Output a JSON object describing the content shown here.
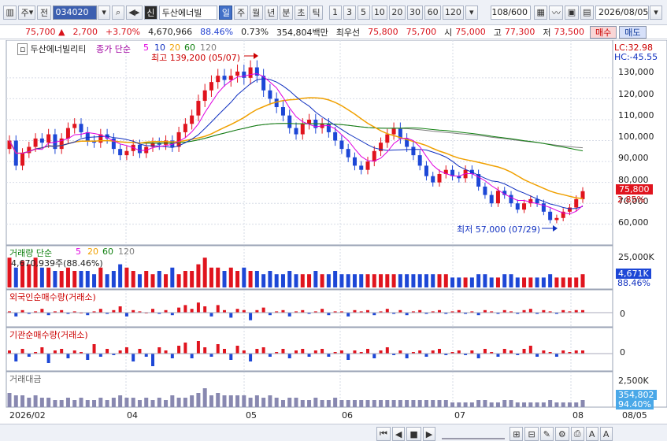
{
  "toolbar": {
    "market_label": "주",
    "period_label": "전",
    "code": "034020",
    "name": "두산에너빌",
    "credit_badge": "신",
    "period_tabs": [
      "일",
      "주",
      "월",
      "년",
      "분",
      "초",
      "틱"
    ],
    "active_period": "일",
    "ticks": [
      "1",
      "3",
      "5",
      "10",
      "20",
      "30",
      "60",
      "120"
    ],
    "count": "108/600",
    "date": "2026/08/05"
  },
  "quote": {
    "price": "75,700",
    "change": "2,700",
    "rate": "+3.70%",
    "volume": "4,670,966",
    "vol_ratio": "88.46%",
    "turnover": "0.73%",
    "amount": "354,804백만",
    "pref_label": "최우선",
    "ask": "75,800",
    "bid": "75,700",
    "open_label": "시",
    "open": "75,000",
    "high_label": "고",
    "high": "77,300",
    "low_label": "저",
    "low": "73,500",
    "buy": "매수",
    "sell": "매도"
  },
  "price_panel": {
    "title": "두산에너빌리티",
    "ma_label": "종가 단순",
    "ma_periods": [
      "5",
      "10",
      "20",
      "60",
      "120"
    ],
    "max_label": "최고 139,200 (05/07)",
    "min_label": "최저 57,000 (07/29)",
    "lc": "LC:32.98",
    "hc": "HC:-45.55",
    "current": "75,800",
    "pct": "2.85%",
    "axis": [
      "130,000",
      "120,000",
      "110,000",
      "100,000",
      "90,000",
      "80,000",
      "70,000",
      "60,000"
    ]
  },
  "volume_panel": {
    "title": "거래량 단순",
    "ma_periods": [
      "5",
      "20",
      "60",
      "120"
    ],
    "info": "4,670,939주(88.46%)",
    "axis_top": "25,000K",
    "current": "4,671K",
    "ratio": "88.46%"
  },
  "foreign_panel": {
    "title": "외국인순매수량(거래소)",
    "zero": "0"
  },
  "inst_panel": {
    "title": "기관순매수량(거래소)",
    "zero": "0"
  },
  "amount_panel": {
    "title": "거래대금",
    "axis_top": "2,500K",
    "current": "354,802",
    "ratio": "94.40%"
  },
  "xaxis": {
    "labels": [
      "2026/02",
      "04",
      "05",
      "06",
      "07",
      "08"
    ],
    "right": "08/05"
  },
  "colors": {
    "up": "#e0141e",
    "down": "#1d47d6",
    "ma5": "#e000e0",
    "ma10": "#1030c0",
    "ma20": "#f0a000",
    "ma60": "#108010",
    "ma120": "#808080"
  },
  "chart_data": {
    "type": "candlestick",
    "max_price": 139200,
    "max_date": "05/07",
    "min_price": 57000,
    "min_date": "07/29",
    "y_range": [
      52000,
      145000
    ],
    "close": [
      100000,
      88000,
      94000,
      97000,
      101000,
      99000,
      103000,
      96000,
      101000,
      106000,
      108000,
      104000,
      100000,
      99000,
      103000,
      101000,
      96000,
      93000,
      95000,
      98000,
      94000,
      97000,
      99000,
      98000,
      100000,
      97000,
      104000,
      108000,
      112000,
      119000,
      124000,
      128000,
      131000,
      129000,
      131000,
      133000,
      130000,
      135000,
      131000,
      124000,
      120000,
      116000,
      112000,
      106000,
      103000,
      108000,
      110000,
      106000,
      108000,
      104000,
      100000,
      96000,
      92000,
      88000,
      86000,
      90000,
      95000,
      99000,
      103000,
      106000,
      101000,
      97000,
      93000,
      88000,
      83000,
      80000,
      84000,
      86000,
      83000,
      82000,
      86000,
      84000,
      78000,
      74000,
      70000,
      76000,
      74000,
      70000,
      67000,
      70000,
      72000,
      70000,
      66000,
      62000,
      63000,
      66000,
      68000,
      72000,
      75800
    ],
    "volume_rel": [
      0.9,
      0.6,
      0.8,
      0.7,
      0.9,
      0.6,
      0.6,
      0.5,
      0.5,
      0.6,
      0.5,
      0.5,
      0.5,
      0.4,
      0.6,
      0.4,
      0.5,
      0.7,
      0.6,
      0.5,
      0.4,
      0.5,
      0.4,
      0.5,
      0.4,
      0.6,
      0.4,
      0.5,
      0.5,
      0.7,
      0.9,
      0.6,
      0.6,
      0.5,
      0.6,
      0.5,
      0.6,
      0.5,
      0.5,
      0.4,
      0.5,
      0.4,
      0.4,
      0.5,
      0.4,
      0.4,
      0.4,
      0.5,
      0.4,
      0.4,
      0.5,
      0.4,
      0.4,
      0.4,
      0.4,
      0.4,
      0.4,
      0.4,
      0.4,
      0.4,
      0.4,
      0.4,
      0.4,
      0.4,
      0.4,
      0.4,
      0.4,
      0.4,
      0.3,
      0.3,
      0.3,
      0.3,
      0.4,
      0.4,
      0.3,
      0.3,
      0.4,
      0.4,
      0.3,
      0.3,
      0.3,
      0.3,
      0.3,
      0.4,
      0.3,
      0.3,
      0.3,
      0.3,
      0.4
    ],
    "foreign_rel": [
      0.1,
      -0.3,
      0.2,
      -0.1,
      0.1,
      0.3,
      -0.2,
      0.1,
      0.2,
      -0.1,
      0.1,
      0.0,
      -0.2,
      0.1,
      0.3,
      -0.1,
      0.2,
      0.5,
      -0.3,
      0.2,
      0.1,
      0.0,
      0.3,
      -0.1,
      0.2,
      -0.2,
      0.4,
      0.6,
      0.3,
      0.8,
      0.5,
      -0.3,
      0.6,
      0.2,
      -0.4,
      0.3,
      0.2,
      -0.6,
      0.2,
      0.4,
      -0.2,
      0.1,
      0.2,
      -0.3,
      0.1,
      0.2,
      -0.1,
      0.1,
      0.3,
      -0.2,
      0.1,
      0.1,
      -0.3,
      0.2,
      0.1,
      0.2,
      -0.2,
      0.1,
      0.3,
      -0.1,
      0.2,
      -0.2,
      0.1,
      0.2,
      -0.1,
      0.1,
      0.2,
      -0.1,
      0.1,
      0.2,
      -0.1,
      0.1,
      -0.2,
      0.2,
      0.1,
      -0.1,
      0.2,
      0.1,
      -0.1,
      0.2,
      0.3,
      -0.1,
      0.2,
      0.1,
      -0.1,
      0.2,
      0.1,
      0.2,
      0.2
    ],
    "inst_rel": [
      0.2,
      -0.5,
      0.3,
      -0.2,
      0.1,
      0.4,
      -0.6,
      0.2,
      0.3,
      -0.3,
      0.2,
      0.1,
      -0.4,
      0.6,
      -0.2,
      0.3,
      -0.1,
      0.2,
      0.4,
      -0.5,
      0.3,
      -0.2,
      -0.8,
      0.4,
      0.2,
      -0.3,
      0.5,
      0.7,
      -0.3,
      0.8,
      0.4,
      -0.2,
      0.6,
      0.3,
      -0.4,
      0.5,
      0.2,
      -0.5,
      0.3,
      0.4,
      -0.2,
      0.1,
      0.3,
      -0.3,
      0.2,
      0.3,
      -0.2,
      0.2,
      0.3,
      -0.2,
      0.1,
      0.2,
      -0.4,
      0.2,
      0.1,
      0.3,
      -0.3,
      0.2,
      0.4,
      -0.1,
      0.2,
      -0.3,
      0.1,
      0.2,
      -0.2,
      0.2,
      0.3,
      -0.1,
      0.1,
      0.2,
      -0.1,
      0.2,
      -0.3,
      0.3,
      0.1,
      -0.2,
      0.3,
      0.2,
      -0.1,
      0.3,
      0.5,
      -0.2,
      0.2,
      0.1,
      -0.2,
      0.2,
      0.1,
      0.2,
      0.2
    ],
    "amount_rel": [
      0.6,
      0.5,
      0.5,
      0.4,
      0.5,
      0.4,
      0.4,
      0.3,
      0.3,
      0.4,
      0.3,
      0.4,
      0.3,
      0.3,
      0.4,
      0.3,
      0.4,
      0.5,
      0.4,
      0.4,
      0.3,
      0.4,
      0.3,
      0.4,
      0.3,
      0.5,
      0.4,
      0.4,
      0.5,
      0.6,
      0.8,
      0.5,
      0.6,
      0.5,
      0.5,
      0.5,
      0.5,
      0.4,
      0.5,
      0.4,
      0.5,
      0.4,
      0.3,
      0.4,
      0.4,
      0.3,
      0.3,
      0.4,
      0.3,
      0.3,
      0.4,
      0.3,
      0.3,
      0.3,
      0.3,
      0.3,
      0.3,
      0.3,
      0.3,
      0.3,
      0.3,
      0.3,
      0.3,
      0.3,
      0.3,
      0.3,
      0.3,
      0.3,
      0.2,
      0.2,
      0.2,
      0.2,
      0.3,
      0.3,
      0.2,
      0.2,
      0.3,
      0.3,
      0.2,
      0.2,
      0.2,
      0.2,
      0.2,
      0.3,
      0.2,
      0.2,
      0.2,
      0.2,
      0.3
    ]
  }
}
